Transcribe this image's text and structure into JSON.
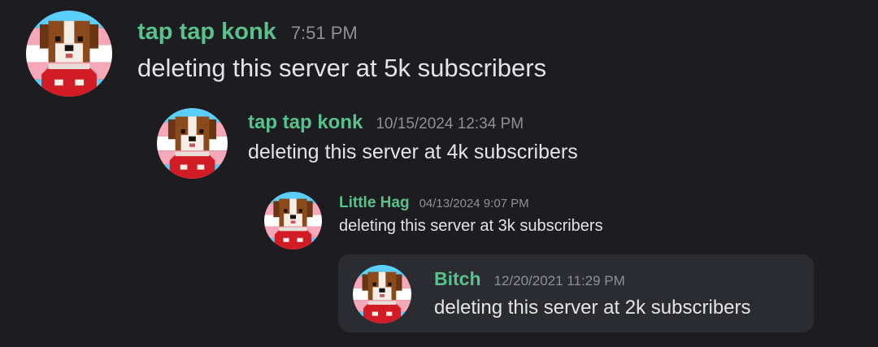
{
  "colors": {
    "background": "#1c1c21",
    "username": "#59c28b",
    "timestamp": "#8f9097",
    "message_text": "#e3e4e8",
    "quote_box": "#2b2c32",
    "avatar_flag_blue": "#5bcefa",
    "avatar_flag_pink": "#f5a9b8",
    "avatar_flag_white": "#ffffff",
    "dog_brown": "#8b4a1c",
    "dog_white": "#f4eee6",
    "sweater_red": "#d11c25"
  },
  "messages": [
    {
      "avatar_icon": "pixel-dog-avatar-icon",
      "username": "tap tap konk",
      "timestamp": "7:51 PM",
      "text": "deleting this server at 5k subscribers"
    },
    {
      "avatar_icon": "pixel-dog-avatar-icon",
      "username": "tap tap konk",
      "timestamp": "10/15/2024 12:34 PM",
      "text": "deleting this server at 4k subscribers"
    },
    {
      "avatar_icon": "pixel-dog-avatar-icon",
      "username": "Little Hag",
      "timestamp": "04/13/2024 9:07 PM",
      "text": "deleting this server at 3k subscribers"
    },
    {
      "avatar_icon": "pixel-dog-avatar-icon",
      "username": "Bitch",
      "timestamp": "12/20/2021 11:29 PM",
      "text": "deleting this server at 2k subscribers"
    }
  ]
}
